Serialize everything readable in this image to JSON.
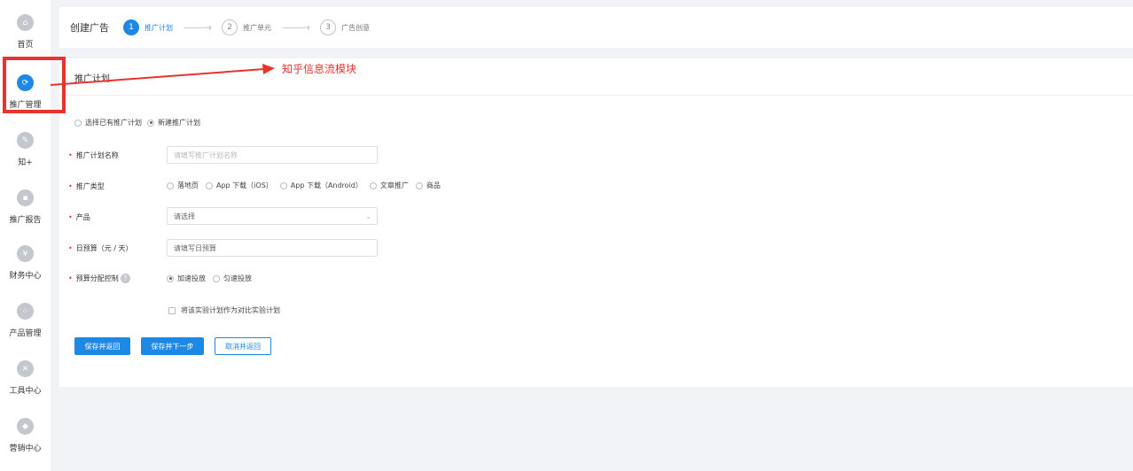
{
  "sidebar": {
    "items": [
      {
        "label": "首页",
        "icon": "home-icon",
        "glyph": "⌂",
        "active": false
      },
      {
        "label": "推广管理",
        "icon": "refresh-icon",
        "glyph": "⟳",
        "active": true
      },
      {
        "label": "知+",
        "icon": "edit-icon",
        "glyph": "✎",
        "active": false
      },
      {
        "label": "推广报告",
        "icon": "chat-icon",
        "glyph": "▪",
        "active": false
      },
      {
        "label": "财务中心",
        "icon": "yuan-icon",
        "glyph": "¥",
        "active": false
      },
      {
        "label": "产品管理",
        "icon": "grid-icon",
        "glyph": "⁘",
        "active": false
      },
      {
        "label": "工具中心",
        "icon": "tools-icon",
        "glyph": "✕",
        "active": false
      },
      {
        "label": "营销中心",
        "icon": "marketing-icon",
        "glyph": "◆",
        "active": false
      }
    ]
  },
  "header": {
    "title": "创建广告",
    "steps": [
      {
        "num": "1",
        "label": "推广计划",
        "active": true
      },
      {
        "num": "2",
        "label": "推广单元",
        "active": false
      },
      {
        "num": "3",
        "label": "广告创意",
        "active": false
      }
    ],
    "arrow": "——→"
  },
  "annotation": {
    "text": "知乎信息流模块",
    "color": "#e8332e"
  },
  "card": {
    "title": "推广计划",
    "plan_choice": {
      "options": [
        "选择已有推广计划",
        "新建推广计划"
      ],
      "selected": 1
    },
    "fields": {
      "plan_name": {
        "label": "推广计划名称",
        "placeholder": "请填写推广计划名称"
      },
      "promo_type": {
        "label": "推广类型",
        "options": [
          "落地页",
          "App 下载（iOS）",
          "App 下载（Android）",
          "文章推广",
          "商品"
        ],
        "selected": -1
      },
      "product": {
        "label": "产品",
        "value": "请选择"
      },
      "daily_budget": {
        "label": "日预算（元 / 天）",
        "placeholder": "请填写日预算"
      },
      "budget_control": {
        "label": "预算分配控制",
        "options": [
          "加速投放",
          "匀速投放"
        ],
        "selected": 0
      },
      "experiment": {
        "label": "将该实验计划作为对比实验计划",
        "checked": false
      }
    },
    "buttons": {
      "save_return": "保存并返回",
      "save_next": "保存并下一步",
      "cancel_return": "取消并返回"
    }
  },
  "colors": {
    "primary": "#1e88e5",
    "required": "#e8332e",
    "background": "#f2f3f6"
  }
}
